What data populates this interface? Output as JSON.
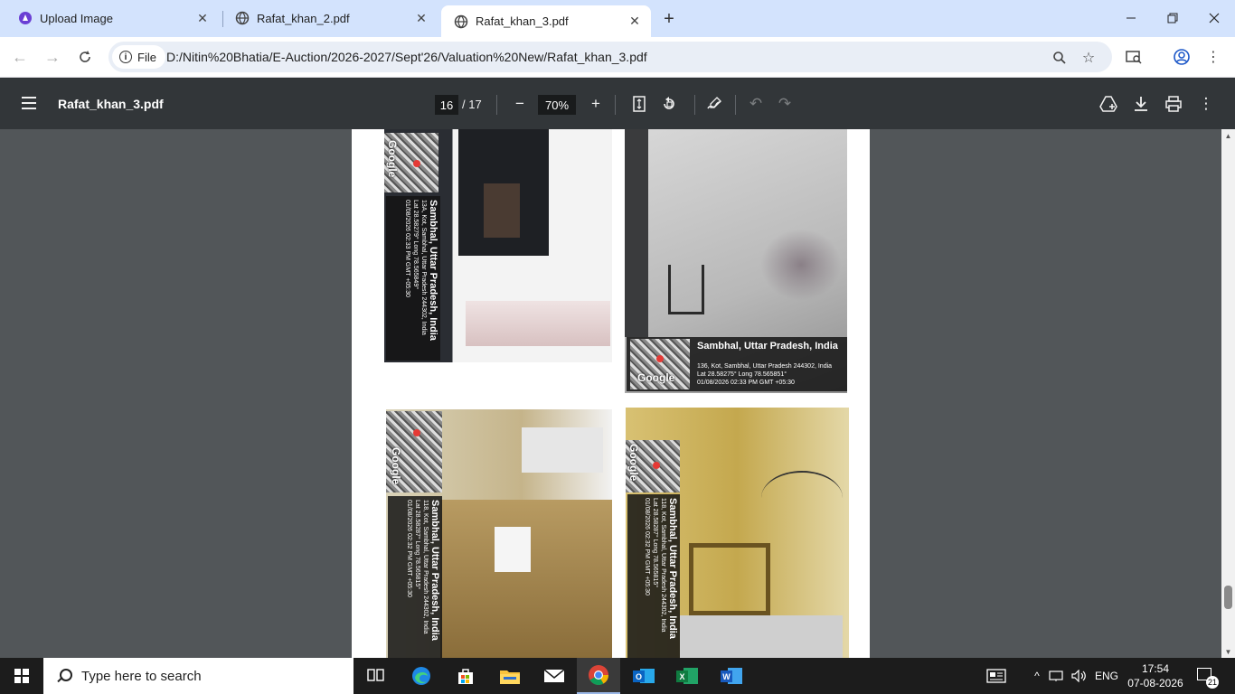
{
  "tabs": [
    {
      "title": "Upload Image",
      "active": false
    },
    {
      "title": "Rafat_khan_2.pdf",
      "active": false
    },
    {
      "title": "Rafat_khan_3.pdf",
      "active": true
    }
  ],
  "omnibox": {
    "chip_label": "File",
    "url": "D:/Nitin%20Bhatia/E-Auction/2026-2027/Sept'26/Valuation%20New/Rafat_khan_3.pdf"
  },
  "pdf": {
    "title": "Rafat_khan_3.pdf",
    "current_page": "16",
    "total_pages": "/ 17",
    "zoom": "70%"
  },
  "photos": [
    {
      "city": "Sambhal, Uttar Pradesh, India",
      "addr": "13A, Kot, Sambhal, Uttar Pradesh 244302, India",
      "coords": "Lat 28.58279° Long 78.565849°",
      "time": "01/08/2026 02:33 PM GMT +05:30"
    },
    {
      "city": "Sambhal, Uttar Pradesh, India",
      "addr": "136, Kot, Sambhal, Uttar Pradesh 244302, India",
      "coords": "Lat 28.58275° Long 78.565851°",
      "time": "01/08/2026 02:33 PM GMT +05:30"
    },
    {
      "city": "Sambhal, Uttar Pradesh, India",
      "addr": "118, Kot, Sambhal, Uttar Pradesh 244302, India",
      "coords": "Lat 28.58287° Long 78.565815°",
      "time": "01/08/2026 02:32 PM GMT +05:30"
    },
    {
      "city": "Sambhal, Uttar Pradesh, India",
      "addr": "118, Kot, Sambhal, Uttar Pradesh 244302, India",
      "coords": "Lat 28.58287° Long 78.565815°",
      "time": "01/08/2026 02:32 PM GMT +05:30"
    }
  ],
  "map_label": "Google",
  "taskbar": {
    "search_placeholder": "Type here to search",
    "language": "ENG",
    "time": "17:54",
    "date": "07-08-2026",
    "notification_count": "21"
  }
}
